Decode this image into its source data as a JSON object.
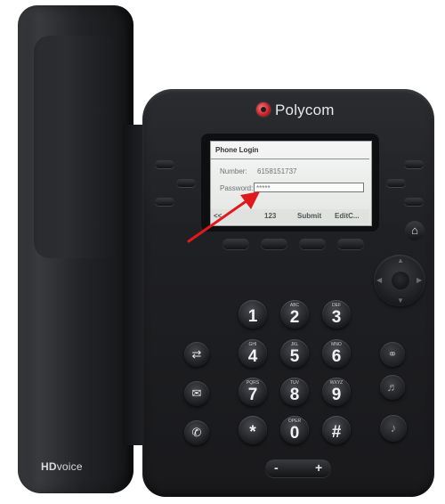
{
  "brand": {
    "name": "Polycom",
    "handset_logo_hd": "HD",
    "handset_logo_voice": "voice"
  },
  "screen": {
    "title": "Phone Login",
    "number_label": "Number:",
    "number_value": "6158151737",
    "password_label": "Password:",
    "password_value": "*****",
    "softkeys": [
      "<<",
      "123",
      "Submit",
      "EditC..."
    ]
  },
  "keypad": [
    {
      "digit": "1",
      "letters": ""
    },
    {
      "digit": "2",
      "letters": "ABC"
    },
    {
      "digit": "3",
      "letters": "DEF"
    },
    {
      "digit": "4",
      "letters": "GHI"
    },
    {
      "digit": "5",
      "letters": "JKL"
    },
    {
      "digit": "6",
      "letters": "MNO"
    },
    {
      "digit": "7",
      "letters": "PQRS"
    },
    {
      "digit": "8",
      "letters": "TUV"
    },
    {
      "digit": "9",
      "letters": "WXYZ"
    },
    {
      "digit": "*",
      "letters": ""
    },
    {
      "digit": "0",
      "letters": "OPER"
    },
    {
      "digit": "#",
      "letters": ""
    }
  ],
  "volume": {
    "minus": "-",
    "plus": "+"
  },
  "icons": {
    "home": "home-icon",
    "transfer": "transfer-icon",
    "messages": "envelope-icon",
    "redial": "redial-icon",
    "headset": "headset-icon",
    "speaker": "speaker-icon",
    "mute": "mute-icon"
  },
  "colors": {
    "annotation_arrow": "#e0191d",
    "brand_logo": "#c41e24"
  }
}
